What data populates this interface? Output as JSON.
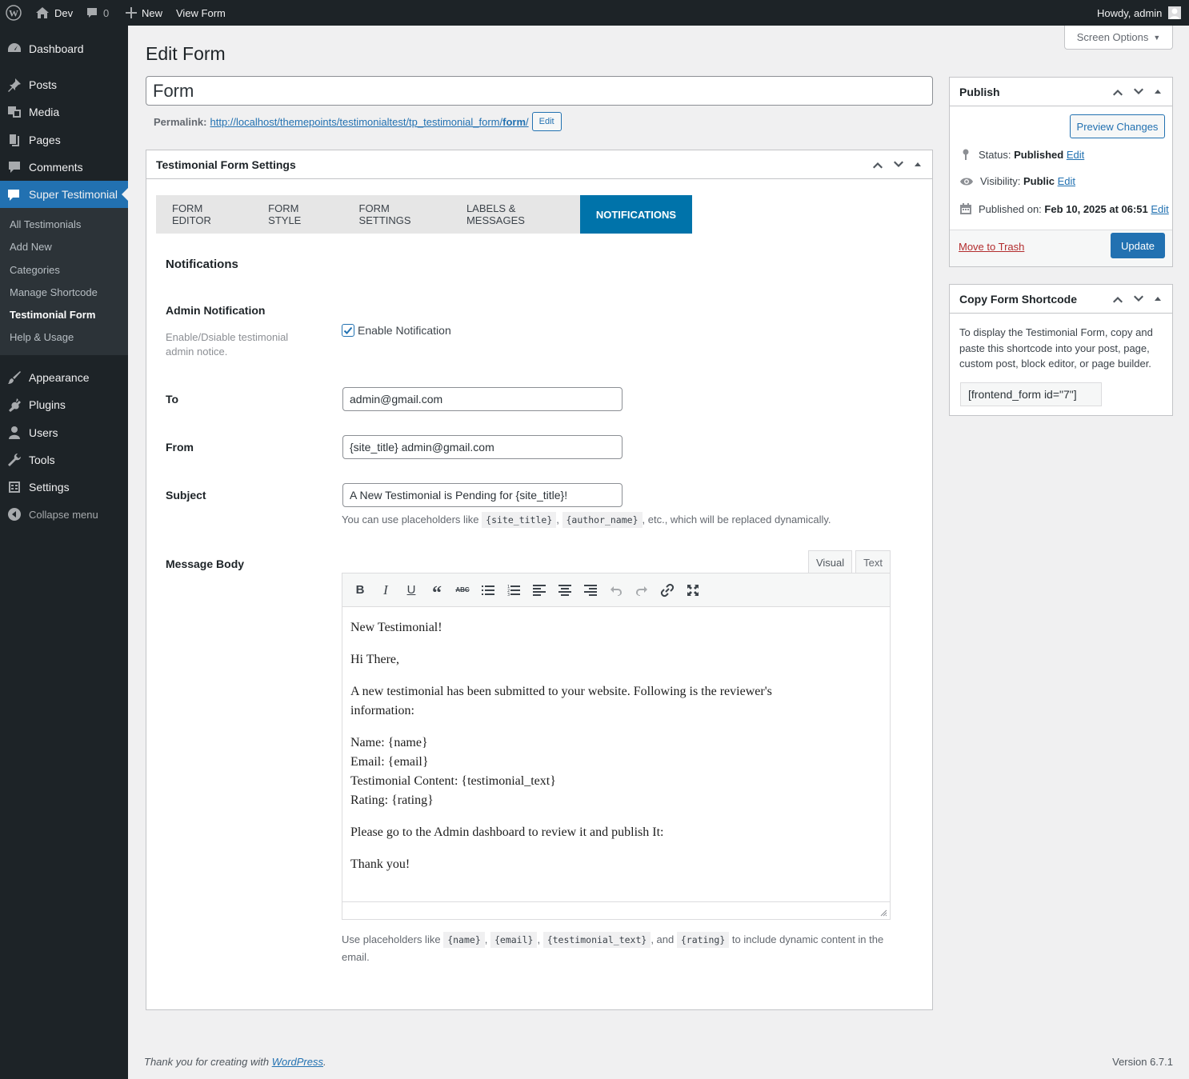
{
  "adminbar": {
    "site_name": "Dev",
    "comments_count": "0",
    "new_label": "New",
    "view_label": "View Form",
    "howdy": "Howdy, admin"
  },
  "sidebar": {
    "items": [
      {
        "label": "Dashboard",
        "icon": "dashboard-icon"
      },
      {
        "label": "Posts",
        "icon": "pin-icon"
      },
      {
        "label": "Media",
        "icon": "media-icon"
      },
      {
        "label": "Pages",
        "icon": "pages-icon"
      },
      {
        "label": "Comments",
        "icon": "comment-icon"
      },
      {
        "label": "Super Testimonial",
        "icon": "testimonial-icon",
        "current": true
      },
      {
        "label": "Appearance",
        "icon": "brush-icon"
      },
      {
        "label": "Plugins",
        "icon": "plugin-icon"
      },
      {
        "label": "Users",
        "icon": "users-icon"
      },
      {
        "label": "Tools",
        "icon": "wrench-icon"
      },
      {
        "label": "Settings",
        "icon": "settings-icon"
      }
    ],
    "submenu": [
      "All Testimonials",
      "Add New",
      "Categories",
      "Manage Shortcode",
      "Testimonial Form",
      "Help & Usage"
    ],
    "submenu_current": "Testimonial Form",
    "collapse": "Collapse menu"
  },
  "screen_options": "Screen Options",
  "page_title": "Edit Form",
  "post_title": "Form",
  "permalink": {
    "label": "Permalink:",
    "url_base": "http://localhost/themepoints/testimonialtest/tp_testimonial_form/",
    "url_slug": "form",
    "edit": "Edit"
  },
  "settings_box": {
    "title": "Testimonial Form Settings",
    "tabs": [
      "Form Editor",
      "Form Style",
      "Form Settings",
      "Labels & Messages",
      "Notifications"
    ],
    "active_tab": "Notifications",
    "section_title": "Notifications",
    "admin_notification": {
      "label": "Admin Notification",
      "desc": "Enable/Dsiable testimonial admin notice.",
      "checkbox_label": "Enable Notification",
      "checked": true
    },
    "to": {
      "label": "To",
      "value": "admin@gmail.com"
    },
    "from": {
      "label": "From",
      "value": "{site_title} admin@gmail.com"
    },
    "subject": {
      "label": "Subject",
      "value": "A New Testimonial is Pending for {site_title}!"
    },
    "subject_hint": {
      "pre": "You can use placeholders like",
      "code1": "{site_title}",
      "sep": ",",
      "code2": "{author_name}",
      "post": ", etc., which will be replaced dynamically."
    },
    "message_body": {
      "label": "Message Body",
      "tab_visual": "Visual",
      "tab_text": "Text",
      "content": {
        "p1": "New Testimonial!",
        "p2": "Hi There,",
        "p3": "A new testimonial has been submitted to your website. Following is the reviewer's information:",
        "l1": "Name: {name}",
        "l2": "Email: {email}",
        "l3": "Testimonial Content: {testimonial_text}",
        "l4": "Rating: {rating}",
        "p5": "Please go to the Admin dashboard to review it and publish It:",
        "p6": "Thank you!"
      }
    },
    "body_hint": {
      "pre": "Use placeholders like",
      "c1": "{name}",
      "c2": "{email}",
      "c3": "{testimonial_text}",
      "and": ", and",
      "c4": "{rating}",
      "post": "to include dynamic content in the email."
    }
  },
  "publish": {
    "title": "Publish",
    "preview": "Preview Changes",
    "status_label": "Status:",
    "status_value": "Published",
    "visibility_label": "Visibility:",
    "visibility_value": "Public",
    "published_label": "Published on:",
    "published_value": "Feb 10, 2025 at 06:51",
    "edit": "Edit",
    "trash": "Move to Trash",
    "update": "Update"
  },
  "shortcode_box": {
    "title": "Copy Form Shortcode",
    "desc": "To display the Testimonial Form, copy and paste this shortcode into your post, page, custom post, block editor, or page builder.",
    "shortcode": "[frontend_form id=\"7\"]"
  },
  "footer": {
    "thanks_pre": "Thank you for creating with",
    "thanks_link": "WordPress",
    "thanks_post": ".",
    "version": "Version 6.7.1"
  },
  "colors": {
    "accent": "#2271b1",
    "tab_active": "#0073aa",
    "sidebar_bg": "#1d2327",
    "trash": "#b32d2e"
  }
}
